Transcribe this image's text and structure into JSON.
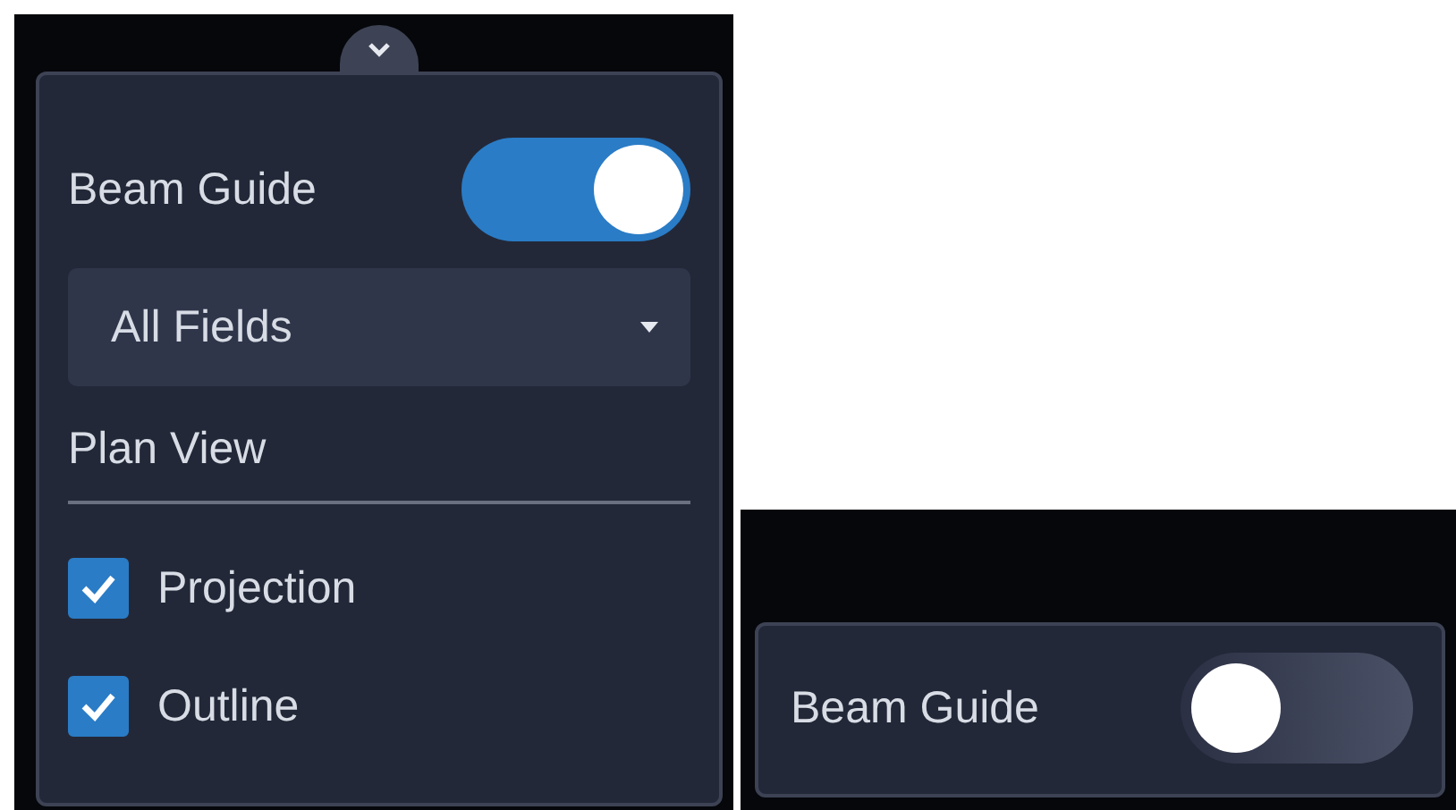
{
  "panels": [
    {
      "kind": "expanded",
      "toggle": {
        "label": "Beam Guide",
        "on": true
      },
      "dropdown": {
        "value": "All Fields"
      },
      "section": "Plan View",
      "checkboxes": [
        {
          "label": "Projection",
          "checked": true
        },
        {
          "label": "Outline",
          "checked": true
        }
      ]
    },
    {
      "kind": "collapsed",
      "toggle": {
        "label": "Beam Guide",
        "on": false
      }
    }
  ]
}
